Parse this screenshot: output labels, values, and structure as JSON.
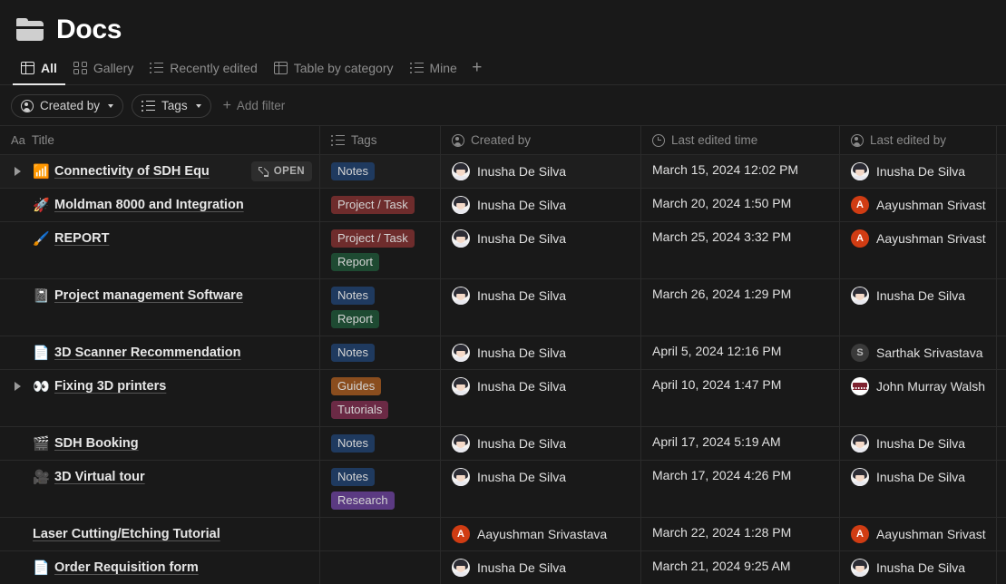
{
  "header": {
    "title": "Docs",
    "icon": "folder-icon"
  },
  "views": {
    "tabs": [
      {
        "label": "All",
        "icon": "table-icon",
        "active": true
      },
      {
        "label": "Gallery",
        "icon": "gallery-icon",
        "active": false
      },
      {
        "label": "Recently edited",
        "icon": "list-icon",
        "active": false
      },
      {
        "label": "Table by category",
        "icon": "table-icon",
        "active": false
      },
      {
        "label": "Mine",
        "icon": "list-icon",
        "active": false
      }
    ],
    "add_label": "+"
  },
  "filters": {
    "chips": [
      {
        "label": "Created by",
        "icon": "person-icon"
      },
      {
        "label": "Tags",
        "icon": "list-icon"
      }
    ],
    "add_filter_label": "Add filter",
    "add_filter_icon": "plus-icon"
  },
  "table": {
    "columns": [
      {
        "label": "Title",
        "icon": "aa-icon"
      },
      {
        "label": "Tags",
        "icon": "list-icon"
      },
      {
        "label": "Created by",
        "icon": "person-icon"
      },
      {
        "label": "Last edited time",
        "icon": "clock-icon"
      },
      {
        "label": "Last edited by",
        "icon": "person-icon"
      }
    ],
    "open_button_label": "OPEN",
    "rows": [
      {
        "title": "Connectivity of SDH Equ",
        "emoji": "📶",
        "emoji_name": "wifi-signal-icon",
        "has_toggle": true,
        "hovered": true,
        "show_open": true,
        "tags": [
          {
            "label": "Notes",
            "color": "#1f3a5f"
          }
        ],
        "created_by": {
          "name": "Inusha De Silva",
          "avatar": "photo"
        },
        "last_edited_time": "March 15, 2024 12:02 PM",
        "last_edited_by": {
          "name": "Inusha De Silva",
          "avatar": "photo"
        }
      },
      {
        "title": "Moldman 8000 and Integration",
        "emoji": "🚀",
        "emoji_name": "rocket-icon",
        "has_toggle": false,
        "hovered": false,
        "show_open": false,
        "tags": [
          {
            "label": "Project / Task",
            "color": "#6e2c2c"
          }
        ],
        "created_by": {
          "name": "Inusha De Silva",
          "avatar": "photo"
        },
        "last_edited_time": "March 20, 2024 1:50 PM",
        "last_edited_by": {
          "name": "Aayushman Srivast",
          "avatar": "initial-A"
        }
      },
      {
        "title": "REPORT",
        "emoji": "🖌️",
        "emoji_name": "paintbrush-icon",
        "has_toggle": false,
        "hovered": false,
        "show_open": false,
        "tags": [
          {
            "label": "Project / Task",
            "color": "#6e2c2c"
          },
          {
            "label": "Report",
            "color": "#1e4a32"
          }
        ],
        "created_by": {
          "name": "Inusha De Silva",
          "avatar": "photo"
        },
        "last_edited_time": "March 25, 2024 3:32 PM",
        "last_edited_by": {
          "name": "Aayushman Srivast",
          "avatar": "initial-A"
        }
      },
      {
        "title": "Project management Software",
        "emoji": "📓",
        "emoji_name": "notebook-icon",
        "has_toggle": false,
        "hovered": false,
        "show_open": false,
        "tags": [
          {
            "label": "Notes",
            "color": "#1f3a5f"
          },
          {
            "label": "Report",
            "color": "#1e4a32"
          }
        ],
        "created_by": {
          "name": "Inusha De Silva",
          "avatar": "photo"
        },
        "last_edited_time": "March 26, 2024 1:29 PM",
        "last_edited_by": {
          "name": "Inusha De Silva",
          "avatar": "photo"
        }
      },
      {
        "title": "3D Scanner Recommendation",
        "emoji": "📄",
        "emoji_name": "document-icon",
        "has_toggle": false,
        "hovered": false,
        "show_open": false,
        "tags": [
          {
            "label": "Notes",
            "color": "#1f3a5f"
          }
        ],
        "created_by": {
          "name": "Inusha De Silva",
          "avatar": "photo"
        },
        "last_edited_time": "April 5, 2024 12:16 PM",
        "last_edited_by": {
          "name": "Sarthak Srivastava",
          "avatar": "initial-S"
        }
      },
      {
        "title": "Fixing 3D printers",
        "emoji": "👀",
        "emoji_name": "eyes-icon",
        "has_toggle": true,
        "hovered": false,
        "show_open": false,
        "tags": [
          {
            "label": "Guides",
            "color": "#8a4d1e"
          },
          {
            "label": "Tutorials",
            "color": "#6b2a45"
          }
        ],
        "created_by": {
          "name": "Inusha De Silva",
          "avatar": "photo"
        },
        "last_edited_time": "April 10, 2024 1:47 PM",
        "last_edited_by": {
          "name": "John Murray Walsh",
          "avatar": "piano"
        }
      },
      {
        "title": "SDH Booking",
        "emoji": "🎬",
        "emoji_name": "clapperboard-icon",
        "has_toggle": false,
        "hovered": false,
        "show_open": false,
        "tags": [
          {
            "label": "Notes",
            "color": "#1f3a5f"
          }
        ],
        "created_by": {
          "name": "Inusha De Silva",
          "avatar": "photo"
        },
        "last_edited_time": "April 17, 2024 5:19 AM",
        "last_edited_by": {
          "name": "Inusha De Silva",
          "avatar": "photo"
        }
      },
      {
        "title": "3D Virtual tour",
        "emoji": "🎥",
        "emoji_name": "movie-camera-icon",
        "has_toggle": false,
        "hovered": false,
        "show_open": false,
        "tags": [
          {
            "label": "Notes",
            "color": "#1f3a5f"
          },
          {
            "label": "Research",
            "color": "#5b3a82"
          }
        ],
        "created_by": {
          "name": "Inusha De Silva",
          "avatar": "photo"
        },
        "last_edited_time": "March 17, 2024 4:26 PM",
        "last_edited_by": {
          "name": "Inusha De Silva",
          "avatar": "photo"
        }
      },
      {
        "title": "Laser Cutting/Etching Tutorial",
        "emoji": "",
        "emoji_name": "no-icon",
        "has_toggle": false,
        "hovered": false,
        "show_open": false,
        "tags": [],
        "created_by": {
          "name": "Aayushman Srivastava",
          "avatar": "initial-A"
        },
        "last_edited_time": "March 22, 2024 1:28 PM",
        "last_edited_by": {
          "name": "Aayushman Srivast",
          "avatar": "initial-A"
        }
      },
      {
        "title": "Order Requisition form",
        "emoji": "📄",
        "emoji_name": "document-icon",
        "has_toggle": false,
        "hovered": false,
        "show_open": false,
        "tags": [],
        "created_by": {
          "name": "Inusha De Silva",
          "avatar": "photo"
        },
        "last_edited_time": "March 21, 2024 9:25 AM",
        "last_edited_by": {
          "name": "Inusha De Silva",
          "avatar": "photo"
        }
      }
    ]
  },
  "theme": {
    "background": "#191919",
    "border": "#2a2a2a",
    "text": "#e6e6e6",
    "muted": "#8a8a8a",
    "avatar_red": "#d03c13",
    "avatar_gray": "#3a3a3a"
  }
}
